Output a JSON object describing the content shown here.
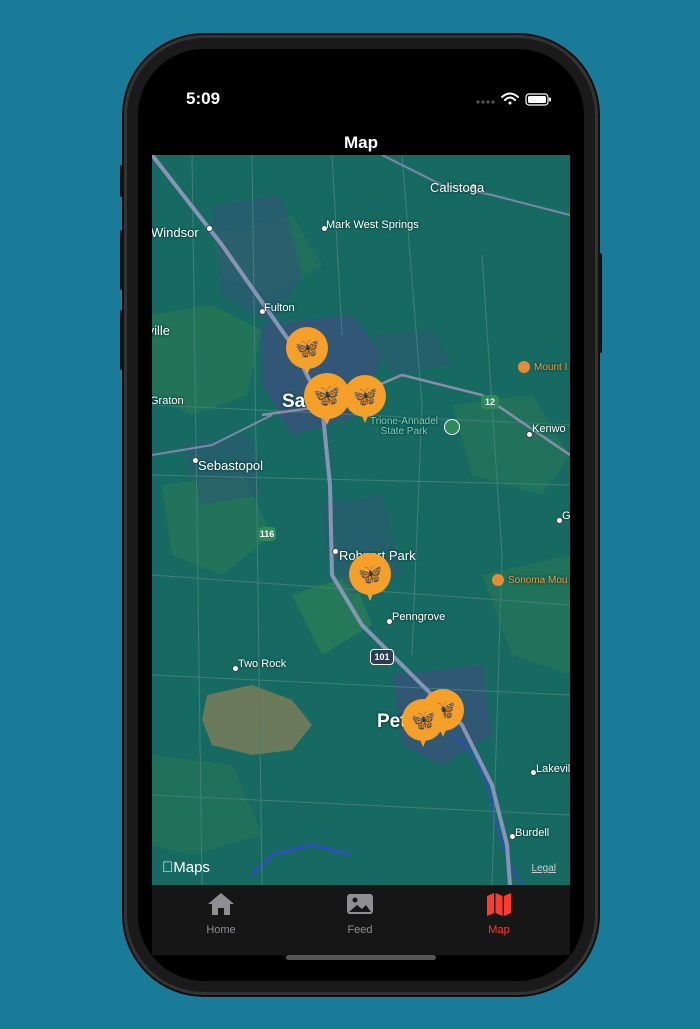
{
  "status": {
    "time": "5:09"
  },
  "nav": {
    "title": "Map"
  },
  "map": {
    "places": {
      "calistoga": "Calistoga",
      "windsor": "Windsor",
      "mark_west": "Mark West Springs",
      "fulton": "Fulton",
      "ville": "tville",
      "graton": "Graton",
      "santa_rosa": "Sa",
      "sebastopol": "Sebastopol",
      "kenwood": "Kenwo",
      "g": "G",
      "rohnert_park": "Rohnert Park",
      "penngrove": "Penngrove",
      "two_rock": "Two Rock",
      "petaluma": "Pet",
      "lakeville": "Lakevil",
      "burdell": "Burdell"
    },
    "parks": {
      "trione": "Trione-Annadel\nState Park"
    },
    "pois": {
      "mount": "Mount I",
      "sonoma_mountain": "Sonoma Mou"
    },
    "shields": {
      "route12": "12",
      "route116": "116",
      "route101": "101"
    },
    "pin_emoji": "🦋",
    "attribution": "Maps",
    "legal": "Legal"
  },
  "tabs": [
    {
      "label": "Home",
      "icon": "house-icon",
      "active": false
    },
    {
      "label": "Feed",
      "icon": "photo-icon",
      "active": false
    },
    {
      "label": "Map",
      "icon": "map-icon",
      "active": true
    }
  ],
  "colors": {
    "accent": "#ff3b30",
    "pin": "#f6a02a",
    "background": "#1a7b99"
  }
}
